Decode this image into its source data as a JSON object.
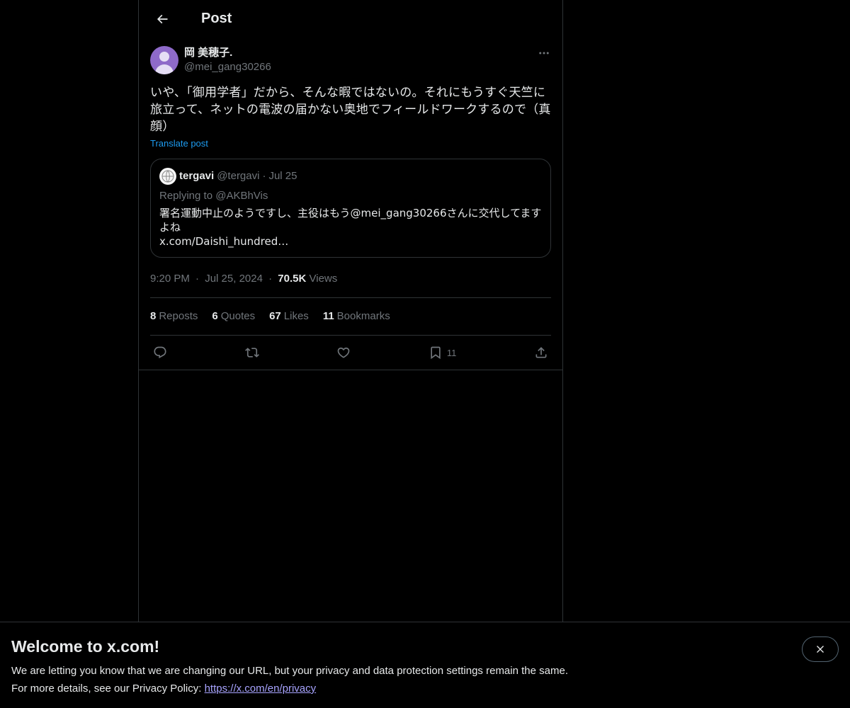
{
  "header": {
    "title": "Post"
  },
  "post": {
    "display_name": "岡 美穂子.",
    "handle": "@mei_gang30266",
    "text": "いや、「御用学者」だから、そんな暇ではないの。それにもうすぐ天竺に旅立って、ネットの電波の届かない奥地でフィールドワークするので（真顔）",
    "translate_label": "Translate post",
    "time": "9:20 PM",
    "date": "Jul 25, 2024",
    "views_count": "70.5K",
    "views_label": "Views"
  },
  "quote": {
    "display_name": "tergavi",
    "handle": "@tergavi",
    "date": "Jul 25",
    "replying": "Replying to @AKBhVis",
    "text_line1": "署名運動中止のようですし、主役はもう@mei_gang30266さんに交代してますよね",
    "text_line2": "x.com/Daishi_hundred…"
  },
  "stats": [
    {
      "num": "8",
      "label": "Reposts"
    },
    {
      "num": "6",
      "label": "Quotes"
    },
    {
      "num": "67",
      "label": "Likes"
    },
    {
      "num": "11",
      "label": "Bookmarks"
    }
  ],
  "actions": {
    "bookmark_count": "11"
  },
  "banner": {
    "title": "Welcome to x.com!",
    "line1": "We are letting you know that we are changing our URL, but your privacy and data protection settings remain the same.",
    "line2_prefix": "For more details, see our Privacy Policy: ",
    "line2_link": "https://x.com/en/privacy"
  },
  "separator": "·"
}
